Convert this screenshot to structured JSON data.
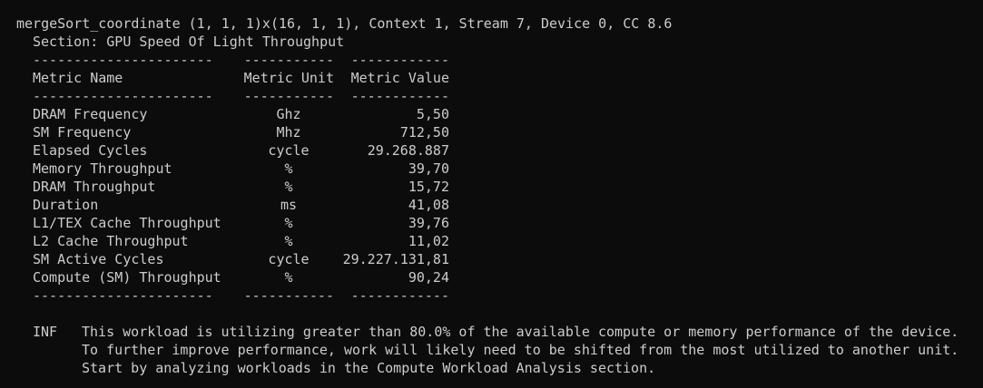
{
  "header": {
    "kernel_line": "mergeSort_coordinate (1, 1, 1)x(16, 1, 1), Context 1, Stream 7, Device 0, CC 8.6",
    "section_line": "Section: GPU Speed Of Light Throughput"
  },
  "table": {
    "separator_name": "----------------------",
    "separator_unit": "-----------",
    "separator_value": "------------",
    "columns": [
      "Metric Name",
      "Metric Unit",
      "Metric Value"
    ],
    "rows": [
      {
        "name": "DRAM Frequency",
        "unit": "Ghz",
        "value": "5,50"
      },
      {
        "name": "SM Frequency",
        "unit": "Mhz",
        "value": "712,50"
      },
      {
        "name": "Elapsed Cycles",
        "unit": "cycle",
        "value": "29.268.887"
      },
      {
        "name": "Memory Throughput",
        "unit": "%",
        "value": "39,70"
      },
      {
        "name": "DRAM Throughput",
        "unit": "%",
        "value": "15,72"
      },
      {
        "name": "Duration",
        "unit": "ms",
        "value": "41,08"
      },
      {
        "name": "L1/TEX Cache Throughput",
        "unit": "%",
        "value": "39,76"
      },
      {
        "name": "L2 Cache Throughput",
        "unit": "%",
        "value": "11,02"
      },
      {
        "name": "SM Active Cycles",
        "unit": "cycle",
        "value": "29.227.131,81"
      },
      {
        "name": "Compute (SM) Throughput",
        "unit": "%",
        "value": "90,24"
      }
    ]
  },
  "info": {
    "tag": "INF",
    "lines": [
      "This workload is utilizing greater than 80.0% of the available compute or memory performance of the device.",
      "To further improve performance, work will likely need to be shifted from the most utilized to another unit.",
      "Start by analyzing workloads in the Compute Workload Analysis section."
    ]
  },
  "colors": {
    "background": "#0c0c0c",
    "foreground": "#cccccc"
  }
}
